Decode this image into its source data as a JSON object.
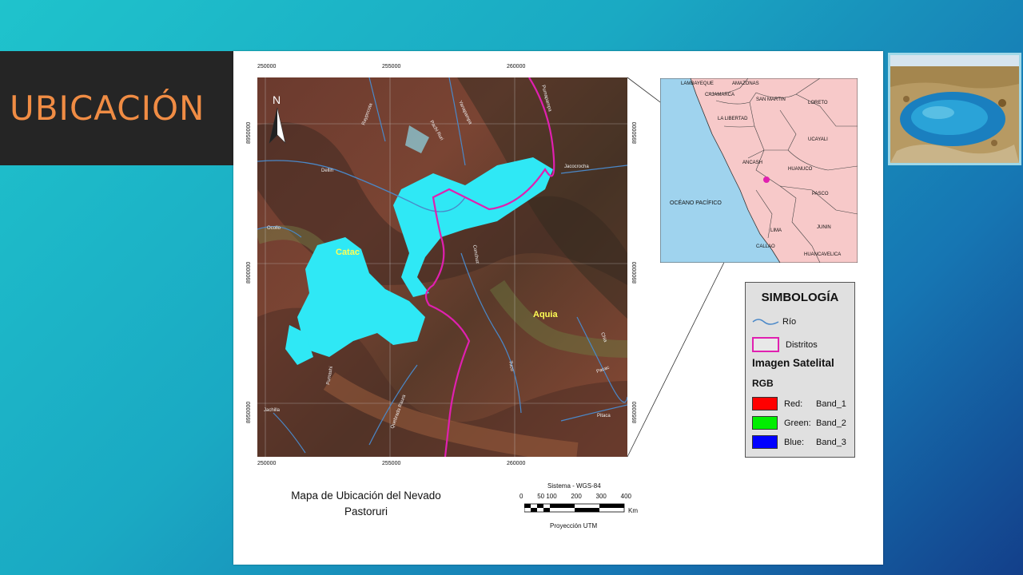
{
  "slide": {
    "title": "UBICACIÓN"
  },
  "map": {
    "x_ticks_top": [
      "250000",
      "255000",
      "260000"
    ],
    "x_ticks_bottom": [
      "250000",
      "255000",
      "260000"
    ],
    "y_ticks_left": [
      "8950000",
      "8900000",
      "8950000"
    ],
    "y_ticks_right": [
      "8950000",
      "8900000",
      "8950000"
    ],
    "places": {
      "catac": "Catac",
      "aquia": "Aquia"
    },
    "rivers": [
      "Dellin",
      "Ocollo",
      "Raypocota",
      "Pachi Ruri",
      "Yanapampa",
      "Pumapampa",
      "Jacocrocha",
      "Conchuz",
      "Jachilla",
      "Quebrada Raura",
      "Tuco",
      "Pumashi",
      "Pacac",
      "Pitaca",
      "Chia"
    ],
    "north": "N",
    "caption_line1": "Mapa de Ubicación del Nevado",
    "caption_line2": "Pastoruri",
    "scale": {
      "system": "Sistema - WGS-84",
      "labels": [
        "0",
        "50 100",
        "200",
        "300",
        "400"
      ],
      "unit": "Km",
      "projection": "Proyección UTM"
    }
  },
  "inset": {
    "ocean": "OCÉANO PACÍFICO",
    "regions": [
      "LAMBAYEQUE",
      "AMAZONAS",
      "CAJAMARCA",
      "SAN MARTIN",
      "LORETO",
      "LA LIBERTAD",
      "UCAYALI",
      "ANCASH",
      "HUANUCO",
      "PASCO",
      "LIMA",
      "CALLAO",
      "JUNIN",
      "HUANCAVELICA"
    ]
  },
  "legend": {
    "title": "SIMBOLOGÍA",
    "river": "Río",
    "districts": "Distritos",
    "image_title": "Imagen Satelital",
    "rgb": "RGB",
    "bands": [
      {
        "label": "Red:",
        "band": "Band_1",
        "color": "#ff0000"
      },
      {
        "label": "Green:",
        "band": "Band_2",
        "color": "#00ee00"
      },
      {
        "label": "Blue:",
        "band": "Band_3",
        "color": "#0000ff"
      }
    ]
  },
  "colors": {
    "title_text": "#f08c44",
    "glacier": "#2fe8f5",
    "district_line": "#e020b0",
    "river_line": "#4a88c8"
  }
}
